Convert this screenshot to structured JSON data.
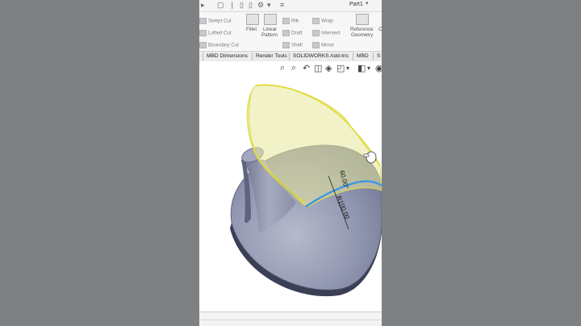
{
  "document": {
    "title": "Part1"
  },
  "ribbon": {
    "swept_cut": "Swept Cut",
    "lofted_cut": "Lofted Cut",
    "boundary_cut": "Boundary Cut",
    "fillet": "Fillet",
    "linear_pattern_1": "Linear",
    "linear_pattern_2": "Pattern",
    "rib": "Rib",
    "draft": "Draft",
    "shell": "Shell",
    "wrap": "Wrap",
    "intersect": "Intersect",
    "mirror": "Mirror",
    "reference_geometry_1": "Reference",
    "reference_geometry_2": "Geometry",
    "curves_partial": "C"
  },
  "tabs": [
    {
      "label": "MBD Dimensions"
    },
    {
      "label": "Render Tools"
    },
    {
      "label": "SOLIDWORKS Add-Ins"
    },
    {
      "label": "MBD"
    },
    {
      "label": "S"
    }
  ],
  "model": {
    "dimension_radius": "R100.00",
    "dimension_angle": "60.00°"
  },
  "colors": {
    "body_shade": "#8a8fa8",
    "sketch_yellow": "#e0dc3c",
    "selection_blue": "#3a96e8",
    "background_side": "#7d8183"
  }
}
